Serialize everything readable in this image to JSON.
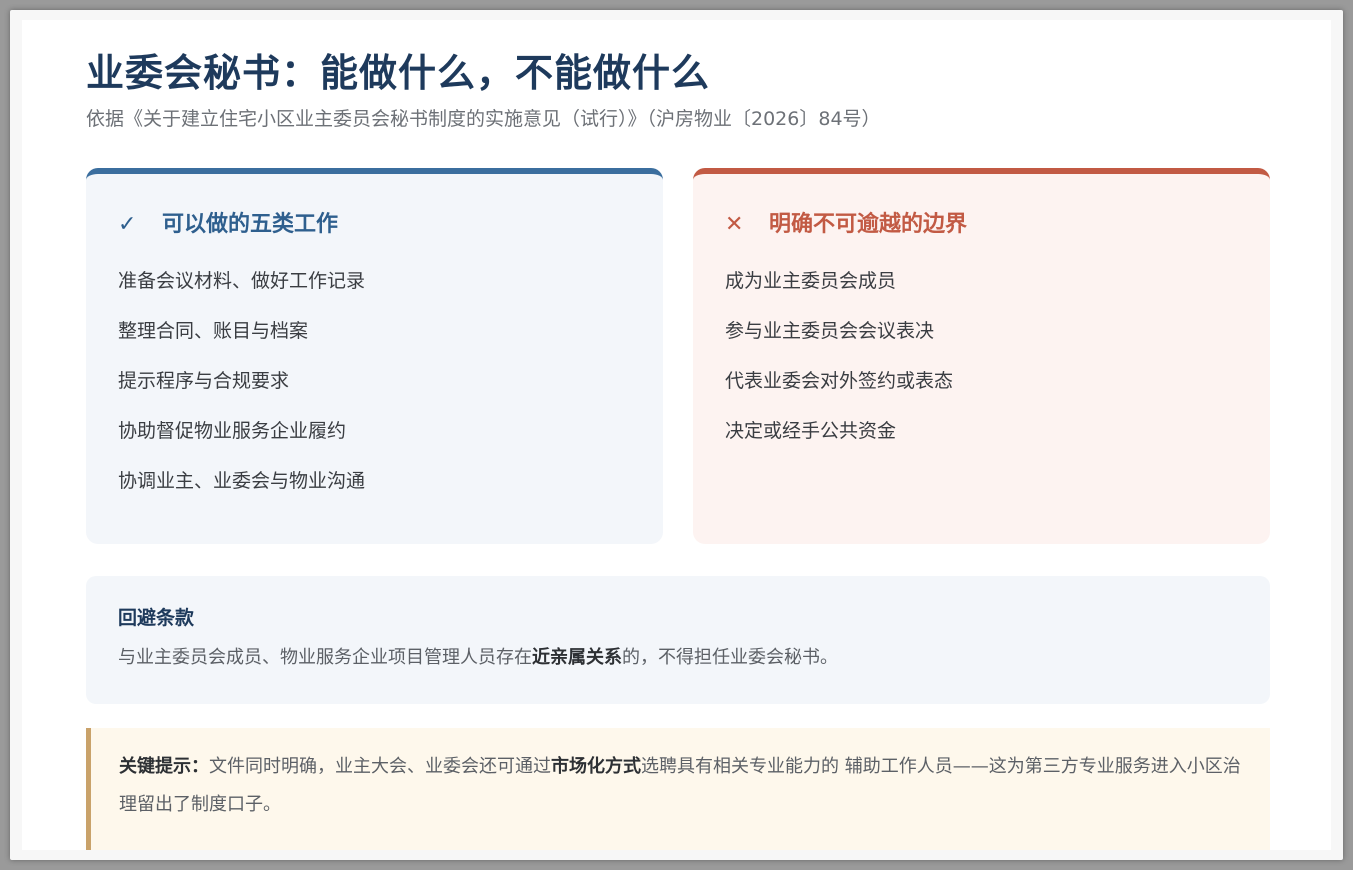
{
  "header": {
    "title": "业委会秘书：能做什么，不能做什么",
    "subtitle": "依据《关于建立住宅小区业主委员会秘书制度的实施意见（试行）》（沪房物业〔2026〕84号）"
  },
  "can_do": {
    "icon": "✓",
    "heading": "可以做的五类工作",
    "accent": "#3b6e9e",
    "items": [
      "准备会议材料、做好工作记录",
      "整理合同、账目与档案",
      "提示程序与合规要求",
      "协助督促物业服务企业履约",
      "协调业主、业委会与物业沟通"
    ]
  },
  "cannot_do": {
    "icon": "✕",
    "heading": "明确不可逾越的边界",
    "accent": "#c25a44",
    "items": [
      "成为业主委员会成员",
      "参与业主委员会会议表决",
      "代表业委会对外签约或表态",
      "决定或经手公共资金"
    ]
  },
  "avoidance": {
    "title": "回避条款",
    "text_before": "与业主委员会成员、物业服务企业项目管理人员存在",
    "text_bold": "近亲属关系",
    "text_after": "的，不得担任业委会秘书。"
  },
  "tip": {
    "label": "关键提示：",
    "text_before": "文件同时明确，业主大会、业委会还可通过",
    "text_bold": "市场化方式",
    "text_after": "选聘具有相关专业能力的 辅助工作人员——这为第三方专业服务进入小区治理留出了制度口子。",
    "accent": "#c9a26a"
  }
}
